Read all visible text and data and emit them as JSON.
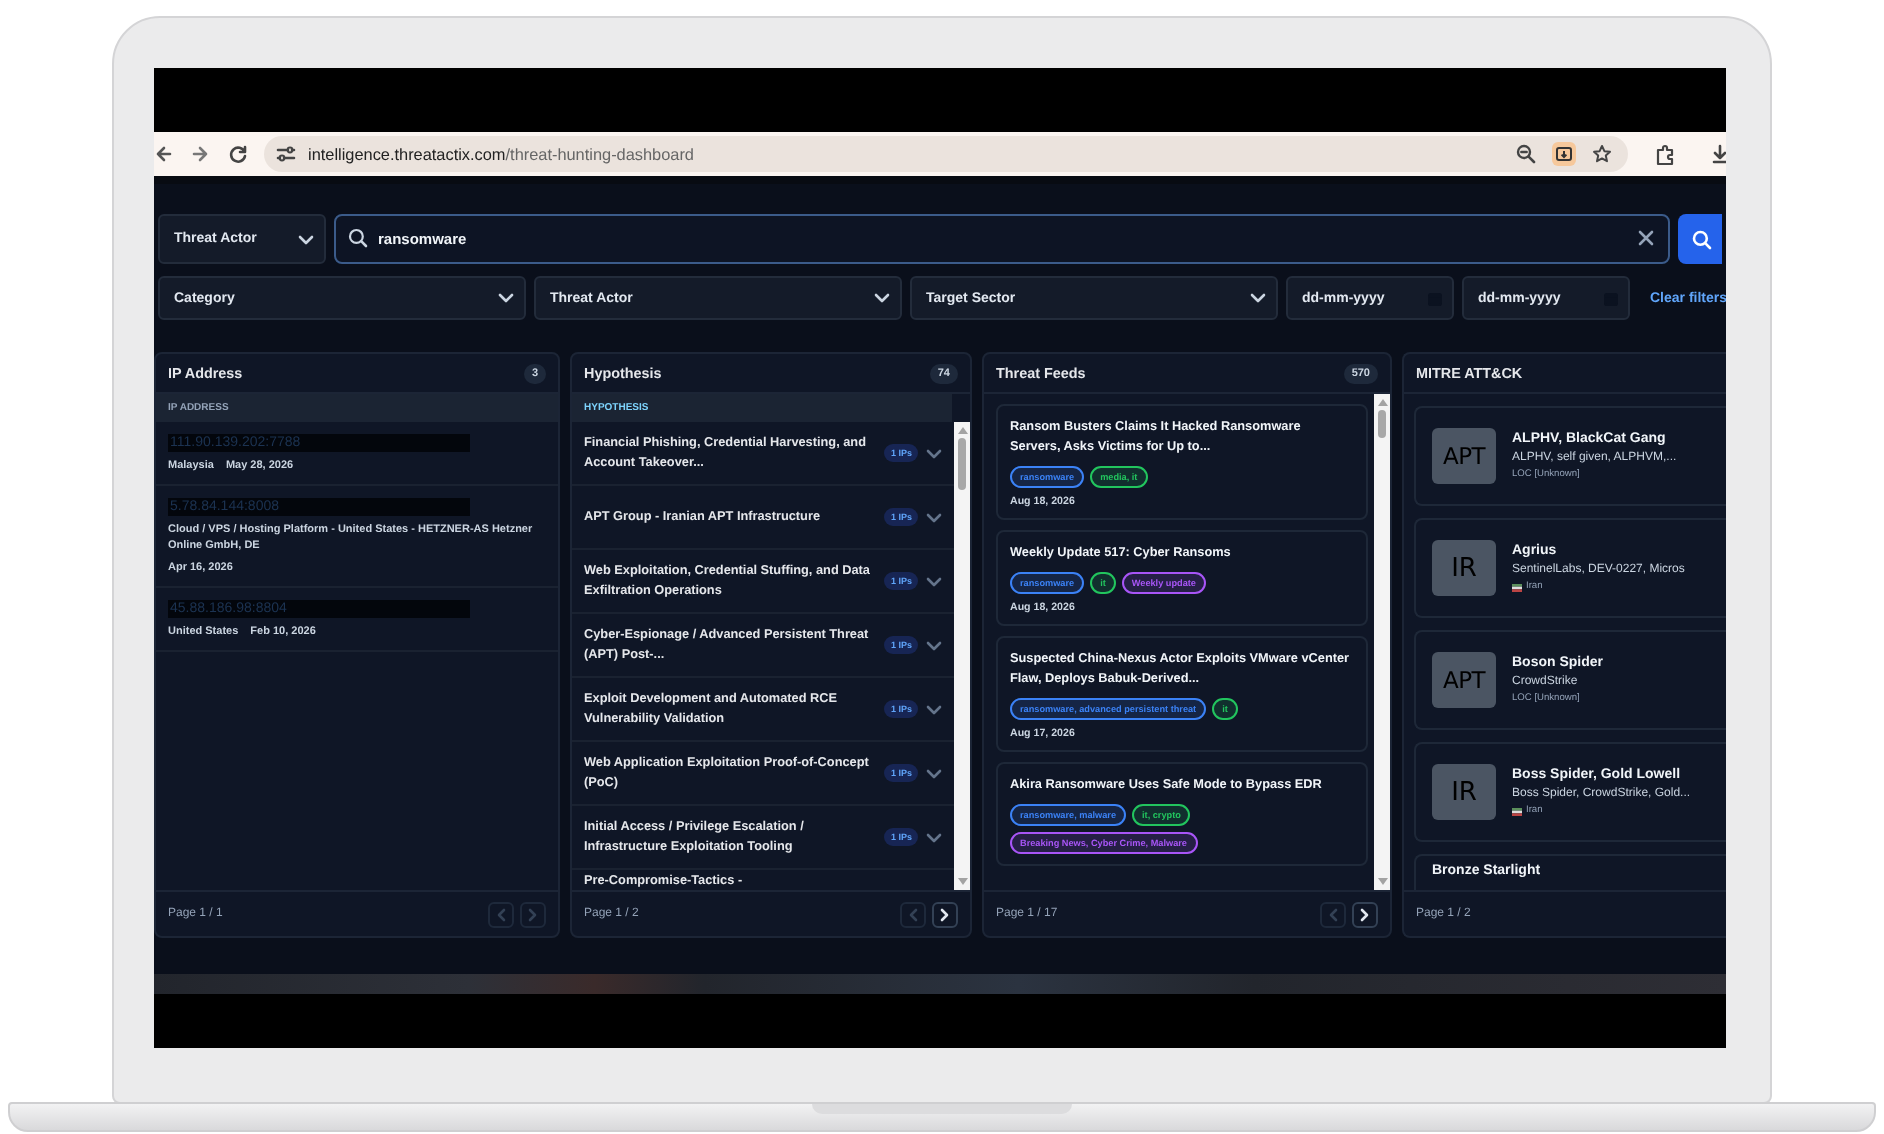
{
  "browser": {
    "url_host": "intelligence.threatactix.com",
    "url_path": "/threat-hunting-dashboard"
  },
  "search": {
    "scope": "Threat Actor",
    "value": "ransomware"
  },
  "filters": [
    {
      "kind": "select",
      "label": "Category"
    },
    {
      "kind": "select",
      "label": "Threat Actor"
    },
    {
      "kind": "select",
      "label": "Target Sector"
    },
    {
      "kind": "date",
      "placeholder": "dd-mm-yyyy"
    },
    {
      "kind": "date",
      "placeholder": "dd-mm-yyyy"
    }
  ],
  "clear_filters": "Clear filters",
  "panels": [
    {
      "kind": "ip",
      "title": "IP Address",
      "count": "3",
      "column": "IP ADDRESS",
      "page": "Page 1 / 1",
      "prev_enabled": false,
      "next_enabled": false,
      "items": [
        {
          "ip": "111.90.139.202:7788",
          "location": "Malaysia",
          "date": "May 28, 2026"
        },
        {
          "ip": "5.78.84.144:8008",
          "location": "Cloud / VPS / Hosting Platform - United States - HETZNER-AS Hetzner Online GmbH, DE",
          "date": "Apr 16, 2026"
        },
        {
          "ip": "45.88.186.98:8804",
          "location": "United States",
          "date": "Feb 10, 2026"
        }
      ]
    },
    {
      "kind": "hypothesis",
      "title": "Hypothesis",
      "count": "74",
      "column": "HYPOTHESIS",
      "page": "Page 1 / 2",
      "prev_enabled": false,
      "next_enabled": true,
      "items": [
        {
          "text": "Financial Phishing, Credential Harvesting, and Account Takeover...",
          "badge": "1 IPs"
        },
        {
          "text": "APT Group - Iranian APT Infrastructure",
          "badge": "1 IPs"
        },
        {
          "text": "Web Exploitation, Credential Stuffing, and Data Exfiltration Operations",
          "badge": "1 IPs"
        },
        {
          "text": "Cyber-Espionage / Advanced Persistent Threat (APT) Post-...",
          "badge": "1 IPs"
        },
        {
          "text": "Exploit Development and Automated RCE Vulnerability Validation",
          "badge": "1 IPs"
        },
        {
          "text": "Web Application Exploitation Proof-of-Concept (PoC)",
          "badge": "1 IPs"
        },
        {
          "text": "Initial Access / Privilege Escalation / Infrastructure Exploitation Tooling",
          "badge": "1 IPs"
        },
        {
          "text": "Pre-Compromise-Tactics -"
        }
      ]
    },
    {
      "kind": "feed",
      "title": "Threat Feeds",
      "count": "570",
      "page": "Page 1 / 17",
      "prev_enabled": false,
      "next_enabled": true,
      "items": [
        {
          "title": "Ransom Busters Claims It Hacked Ransomware Servers, Asks Victims for Up to...",
          "tags": [
            {
              "text": "ransomware",
              "color": "#3b82f6"
            },
            {
              "text": "media, it",
              "color": "#22c55e"
            }
          ],
          "date": "Aug 18, 2026"
        },
        {
          "title": "Weekly Update 517: Cyber Ransoms",
          "tags": [
            {
              "text": "ransomware",
              "color": "#3b82f6"
            },
            {
              "text": "it",
              "color": "#22c55e"
            },
            {
              "text": "Weekly update",
              "color": "#a855f7"
            }
          ],
          "date": "Aug 18, 2026"
        },
        {
          "title": "Suspected China-Nexus Actor Exploits VMware vCenter Flaw, Deploys Babuk-Derived...",
          "tags": [
            {
              "text": "ransomware, advanced persistent threat",
              "color": "#3b82f6"
            },
            {
              "text": "it",
              "color": "#22c55e"
            }
          ],
          "date": "Aug 17, 2026"
        },
        {
          "title": "Akira Ransomware Uses Safe Mode to Bypass EDR",
          "tags": [
            {
              "text": "ransomware, malware",
              "color": "#3b82f6"
            },
            {
              "text": "it, crypto",
              "color": "#22c55e"
            },
            {
              "text": "Breaking News, Cyber Crime, Malware",
              "color": "#a855f7"
            }
          ]
        }
      ]
    },
    {
      "kind": "mitre",
      "title": "MITRE ATT&CK",
      "page": "Page 1 / 2",
      "items": [
        {
          "avatar": "APT",
          "name": "ALPHV, BlackCat Gang",
          "aliases": "ALPHV, self given, ALPHVM,...",
          "location": "LOC [Unknown]",
          "flag": false
        },
        {
          "avatar": "IR",
          "name": "Agrius",
          "aliases": "SentinelLabs, DEV-0227, Micros",
          "location": "Iran",
          "flag": true
        },
        {
          "avatar": "APT",
          "name": "Boson Spider",
          "aliases": "CrowdStrike",
          "location": "LOC [Unknown]",
          "flag": false
        },
        {
          "avatar": "IR",
          "name": "Boss Spider, Gold Lowell",
          "aliases": "Boss Spider, CrowdStrike, Gold...",
          "location": "Iran",
          "flag": true
        },
        {
          "name": "Bronze Starlight"
        }
      ]
    }
  ]
}
